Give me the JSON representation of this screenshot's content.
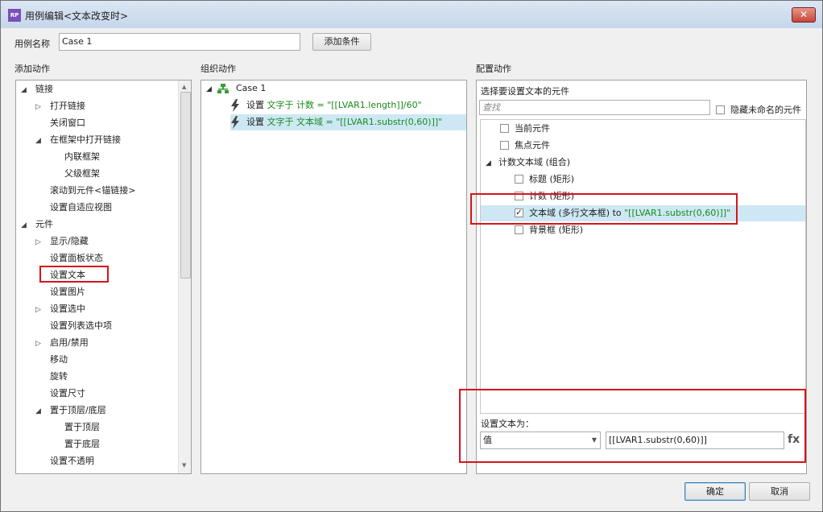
{
  "window": {
    "title": "用例编辑<文本改变时>",
    "app_icon": "RP",
    "close_glyph": "✕"
  },
  "case_name": {
    "label": "用例名称",
    "value": "Case 1",
    "add_condition_label": "添加条件"
  },
  "add_actions": {
    "header": "添加动作",
    "items": [
      {
        "label": "链接",
        "indent": 0,
        "arrow": "open"
      },
      {
        "label": "打开链接",
        "indent": 1,
        "arrow": "closed"
      },
      {
        "label": "关闭窗口",
        "indent": 1,
        "arrow": "none"
      },
      {
        "label": "在框架中打开链接",
        "indent": 1,
        "arrow": "open"
      },
      {
        "label": "内联框架",
        "indent": 2,
        "arrow": "none"
      },
      {
        "label": "父级框架",
        "indent": 2,
        "arrow": "none"
      },
      {
        "label": "滚动到元件<锚链接>",
        "indent": 1,
        "arrow": "none"
      },
      {
        "label": "设置自适应视图",
        "indent": 1,
        "arrow": "none"
      },
      {
        "label": "元件",
        "indent": 0,
        "arrow": "open"
      },
      {
        "label": "显示/隐藏",
        "indent": 1,
        "arrow": "closed"
      },
      {
        "label": "设置面板状态",
        "indent": 1,
        "arrow": "none"
      },
      {
        "label": "设置文本",
        "indent": 1,
        "arrow": "none",
        "highlighted": true
      },
      {
        "label": "设置图片",
        "indent": 1,
        "arrow": "none"
      },
      {
        "label": "设置选中",
        "indent": 1,
        "arrow": "closed"
      },
      {
        "label": "设置列表选中项",
        "indent": 1,
        "arrow": "none"
      },
      {
        "label": "启用/禁用",
        "indent": 1,
        "arrow": "closed"
      },
      {
        "label": "移动",
        "indent": 1,
        "arrow": "none"
      },
      {
        "label": "旋转",
        "indent": 1,
        "arrow": "none"
      },
      {
        "label": "设置尺寸",
        "indent": 1,
        "arrow": "none"
      },
      {
        "label": "置于顶层/底层",
        "indent": 1,
        "arrow": "open"
      },
      {
        "label": "置于顶层",
        "indent": 2,
        "arrow": "none"
      },
      {
        "label": "置于底层",
        "indent": 2,
        "arrow": "none"
      },
      {
        "label": "设置不透明",
        "indent": 1,
        "arrow": "none"
      }
    ]
  },
  "organize": {
    "header": "组织动作",
    "case_label": "Case 1",
    "actions": [
      {
        "prefix": "设置 ",
        "target": "文字于 计数",
        "value": " = \"[[LVAR1.length]]/60\"",
        "selected": false
      },
      {
        "prefix": "设置 ",
        "target": "文字于 文本域",
        "value": " = \"[[LVAR1.substr(0,60)]]\"",
        "selected": true
      }
    ]
  },
  "configure": {
    "header": "配置动作",
    "select_label": "选择要设置文本的元件",
    "search_placeholder": "查找",
    "hide_unnamed_label": "隐藏未命名的元件",
    "tree": [
      {
        "label": "当前元件",
        "indent": 1,
        "checked": false,
        "value": ""
      },
      {
        "label": "焦点元件",
        "indent": 1,
        "checked": false,
        "value": ""
      },
      {
        "label": "计数文本域 (组合)",
        "indent": 0,
        "group": true,
        "checked": false,
        "value": ""
      },
      {
        "label": "标题 (矩形)",
        "indent": 2,
        "checked": false,
        "value": ""
      },
      {
        "label": "计数 (矩形)",
        "indent": 2,
        "checked": false,
        "value": ""
      },
      {
        "label": "文本域 (多行文本框) to ",
        "indent": 2,
        "checked": true,
        "value": "\"[[LVAR1.substr(0,60)]]\"",
        "selected": true
      },
      {
        "label": "背景框 (矩形)",
        "indent": 2,
        "checked": false,
        "value": ""
      }
    ],
    "set_text_label": "设置文本为：",
    "type_value": "值",
    "text_value": "[[LVAR1.substr(0,60)]]",
    "fx_label": "fx"
  },
  "footer": {
    "ok_label": "确定",
    "cancel_label": "取消"
  }
}
